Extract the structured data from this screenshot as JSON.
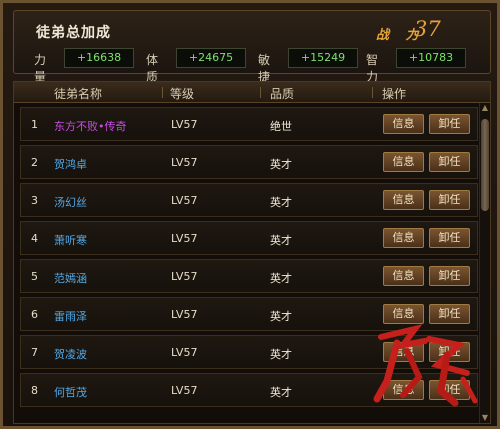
{
  "summary": {
    "title": "徒弟总加成",
    "power_label": "战 力",
    "power_value": "37",
    "stats": [
      {
        "label": "力量",
        "value": "+16638"
      },
      {
        "label": "体质",
        "value": "+24675"
      },
      {
        "label": "敏捷",
        "value": "+15249"
      },
      {
        "label": "智力",
        "value": "+10783"
      }
    ]
  },
  "table": {
    "headers": {
      "name": "徒弟名称",
      "level": "等级",
      "quality": "品质",
      "action": "操作"
    },
    "rows": [
      {
        "index": "1",
        "name": "东方不败•传奇",
        "level": "LV57",
        "quality": "绝世",
        "info": "信息",
        "dismiss": "卸任"
      },
      {
        "index": "2",
        "name": "贺鸿卓",
        "level": "LV57",
        "quality": "英才",
        "info": "信息",
        "dismiss": "卸任"
      },
      {
        "index": "3",
        "name": "汤幻丝",
        "level": "LV57",
        "quality": "英才",
        "info": "信息",
        "dismiss": "卸任"
      },
      {
        "index": "4",
        "name": "萧听寒",
        "level": "LV57",
        "quality": "英才",
        "info": "信息",
        "dismiss": "卸任"
      },
      {
        "index": "5",
        "name": "范嫣涵",
        "level": "LV57",
        "quality": "英才",
        "info": "信息",
        "dismiss": "卸任"
      },
      {
        "index": "6",
        "name": "雷雨泽",
        "level": "LV57",
        "quality": "英才",
        "info": "信息",
        "dismiss": "卸任"
      },
      {
        "index": "7",
        "name": "贺凌波",
        "level": "LV57",
        "quality": "英才",
        "info": "信息",
        "dismiss": "卸任"
      },
      {
        "index": "8",
        "name": "何哲茂",
        "level": "LV57",
        "quality": "英才",
        "info": "信息",
        "dismiss": "卸任"
      }
    ]
  },
  "colors": {
    "legend_name": "#c44ee0",
    "normal_name": "#52a9e6",
    "stat_value": "#7ee06a",
    "power": "#e8a23c"
  },
  "icons": {
    "scroll_up": "triangle-up-icon",
    "scroll_down": "triangle-down-icon",
    "watermark": "calligraphy-watermark-icon"
  }
}
